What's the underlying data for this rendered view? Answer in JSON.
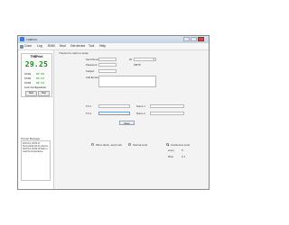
{
  "window": {
    "title": "THBPrint"
  },
  "menu": [
    {
      "label": "Conn"
    },
    {
      "label": "Log"
    },
    {
      "label": "RAM"
    },
    {
      "label": "Mod"
    },
    {
      "label": "Get device"
    },
    {
      "label": "Tool"
    },
    {
      "label": "Help"
    }
  ],
  "meter": {
    "title": "THBPrint",
    "reading": "29.25",
    "rows": [
      {
        "label": "Ch01",
        "value": "09.68"
      },
      {
        "label": "Ch02",
        "value": "09.03"
      },
      {
        "label": "Ch03",
        "value": "08.24"
      }
    ],
    "status": "Link Configuration",
    "buttons": [
      "Start",
      "Stop"
    ]
  },
  "messages": {
    "title": "Prompt Message",
    "lines": [
      "2017/1/1 18:29:17 Successfull link the Device.",
      "2017/1/1 18:29:19 Start to read the temperature."
    ]
  },
  "form": {
    "group_title": "Transmit e-mail on setup",
    "send_server_label": "Send Server",
    "send_server_value": "",
    "port_label": "25",
    "password_label": "Password",
    "password_value": "",
    "protocol": "SMTP",
    "subject_label": "Subject",
    "subject_value": "",
    "additional_label": "Add Emotion",
    "additional_value": "",
    "to1_label": "TO 1",
    "name1_label": "Name 1",
    "to2_label": "TO 2",
    "name2_label": "Name 2",
    "save_button": "Save",
    "radio_when_alarm": "When alarm, send mail",
    "radio_interval": "Interval send",
    "radio_continuous": "Continuous send",
    "every_label": "every",
    "every_value": "5",
    "mins_label": "Mins",
    "mins_value": "0.1"
  }
}
